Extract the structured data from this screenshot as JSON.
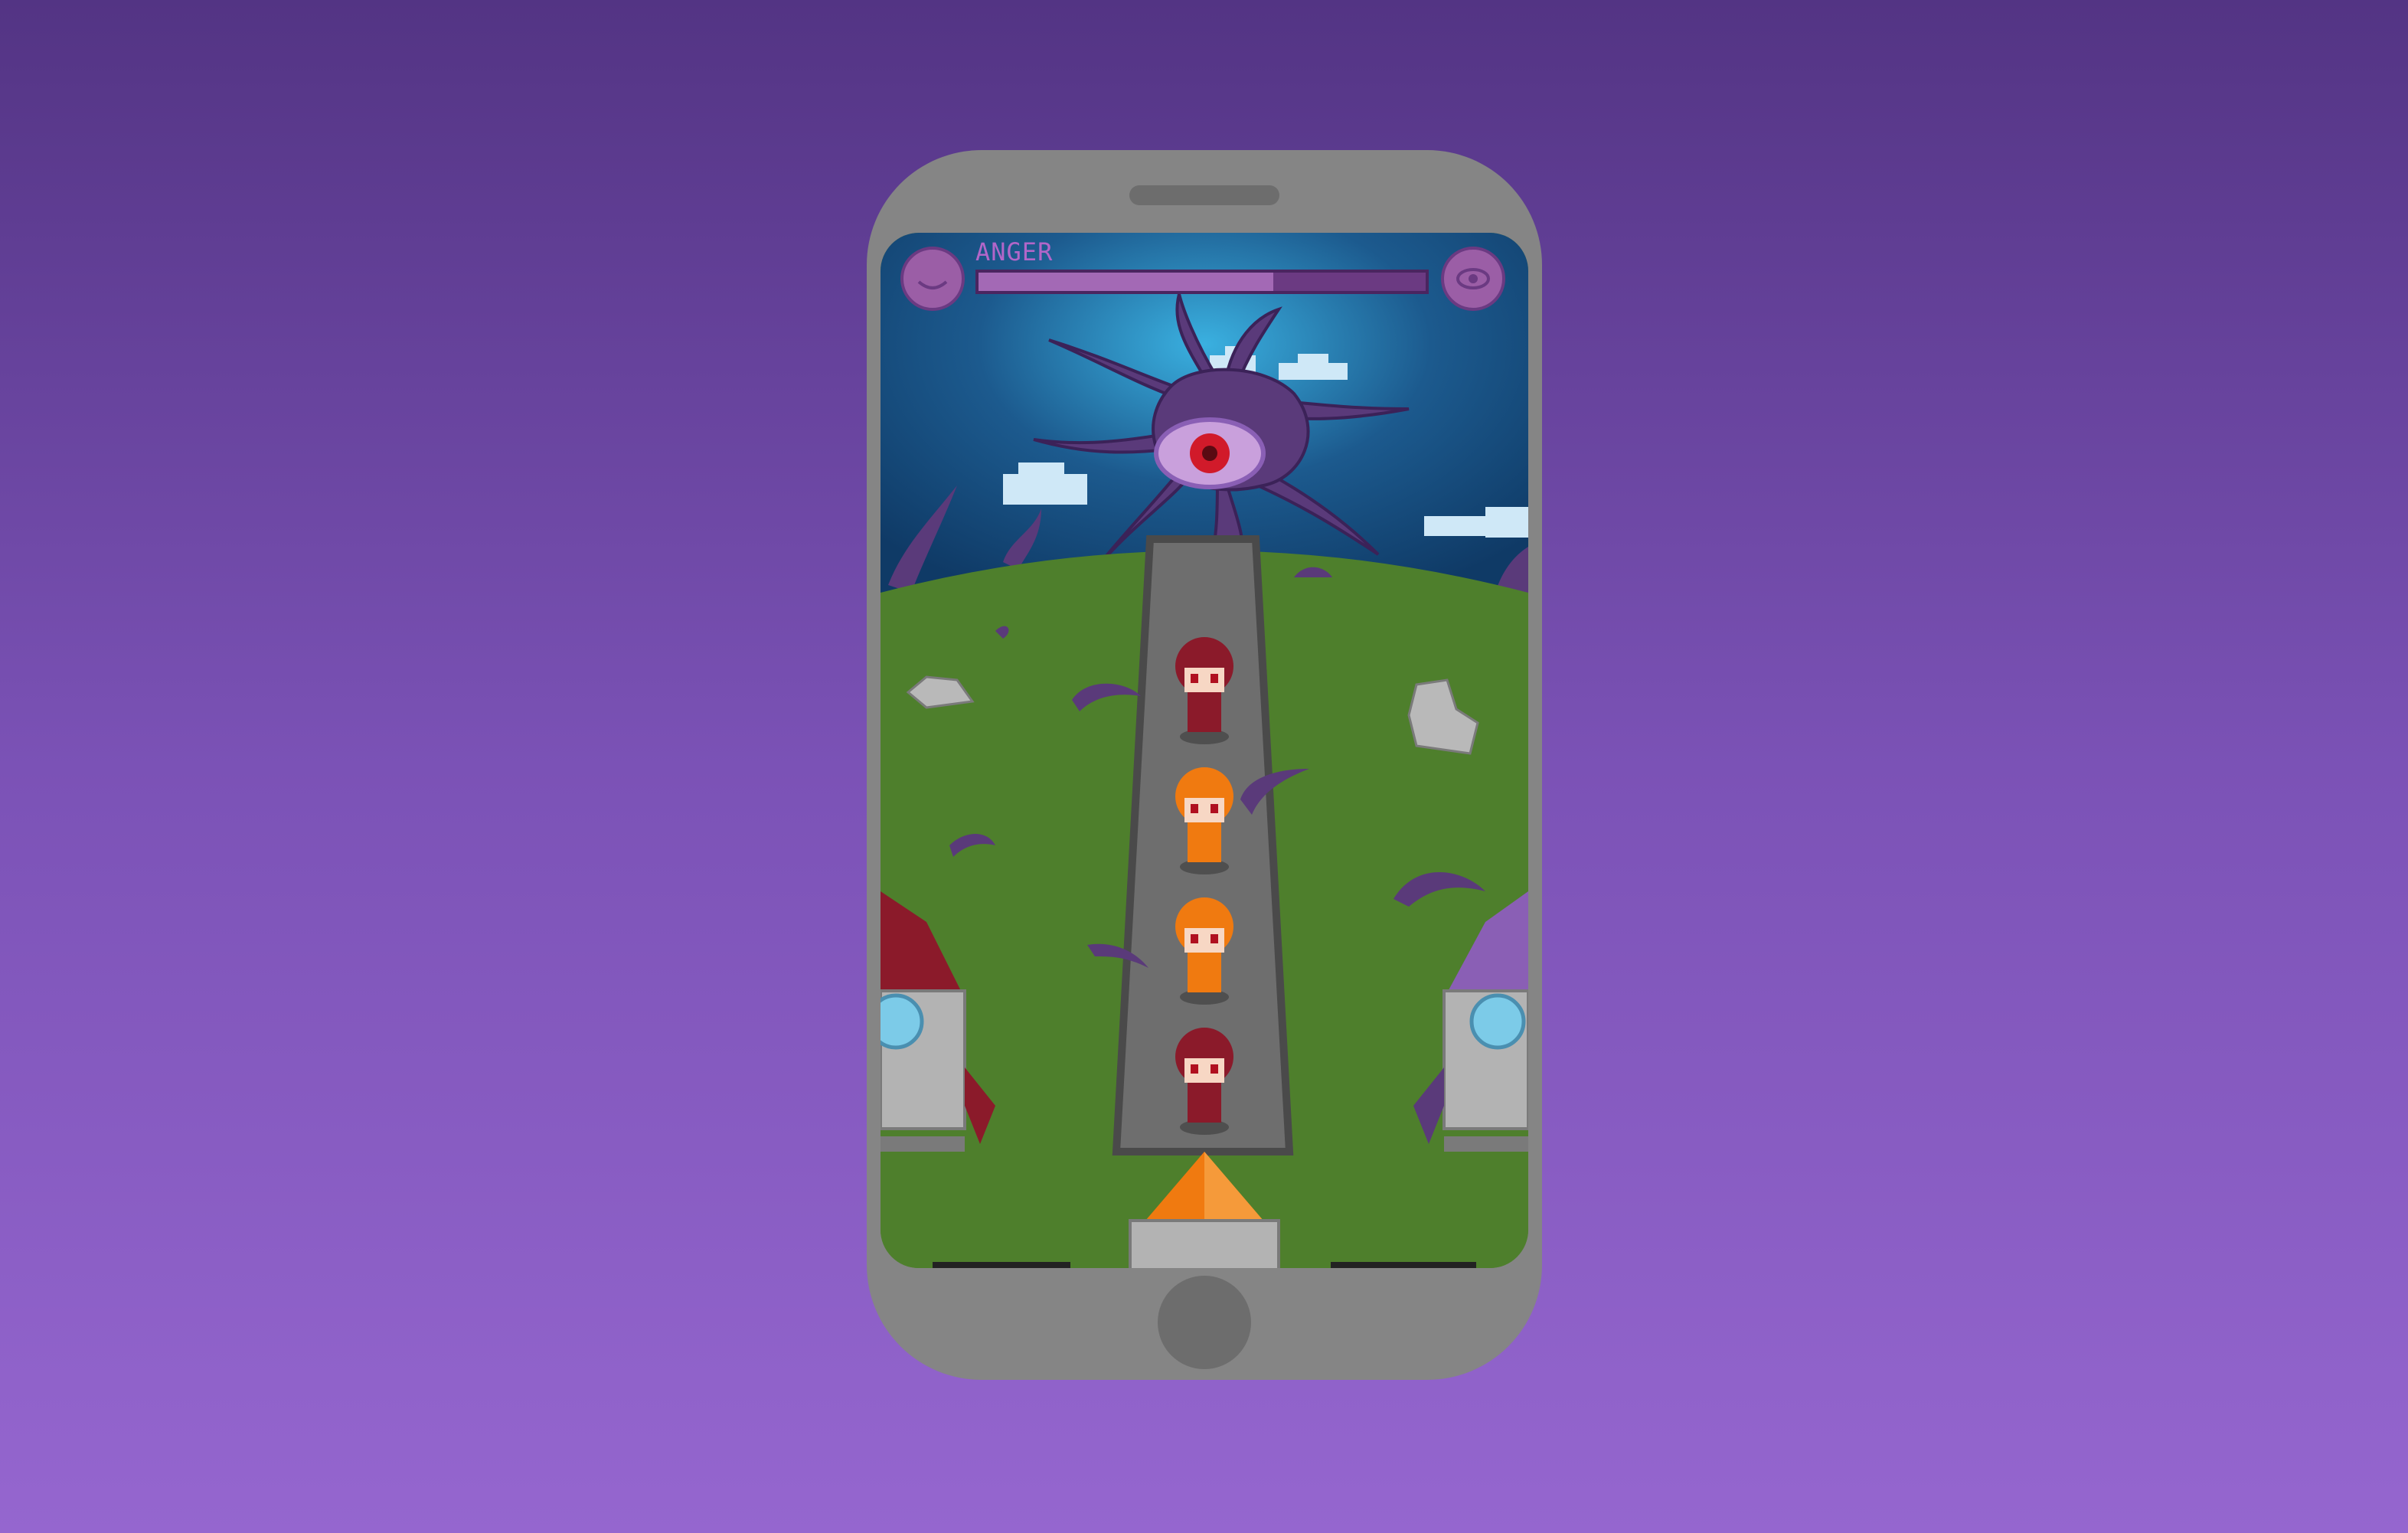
{
  "hud": {
    "anger_label": "ANGER",
    "anger_level": 0.66,
    "left_button_icon": "moon-icon",
    "right_button_icon": "eye-icon"
  },
  "scene": {
    "boss": "tentacle-eye-monster",
    "queue": [
      {
        "name": "red-haired-kid",
        "color": "#8b1a2a"
      },
      {
        "name": "orange-haired-kid",
        "color": "#f07a10"
      },
      {
        "name": "orange-haired-kid",
        "color": "#f07a10"
      },
      {
        "name": "red-haired-kid",
        "color": "#8b1a2a"
      }
    ],
    "rockets": [
      {
        "side": "left",
        "nose_color": "#8b1a2a"
      },
      {
        "side": "right",
        "nose_color": "#8a5fb5"
      },
      {
        "side": "bottom",
        "nose_color": "#f07a10"
      }
    ]
  },
  "colors": {
    "background_top": "#533484",
    "background_bottom": "#9566cf",
    "sky": "#1c5a8e",
    "grass": "#4e7f2c",
    "path": "#6e6e6e",
    "tentacle": "#5a3a7a"
  }
}
